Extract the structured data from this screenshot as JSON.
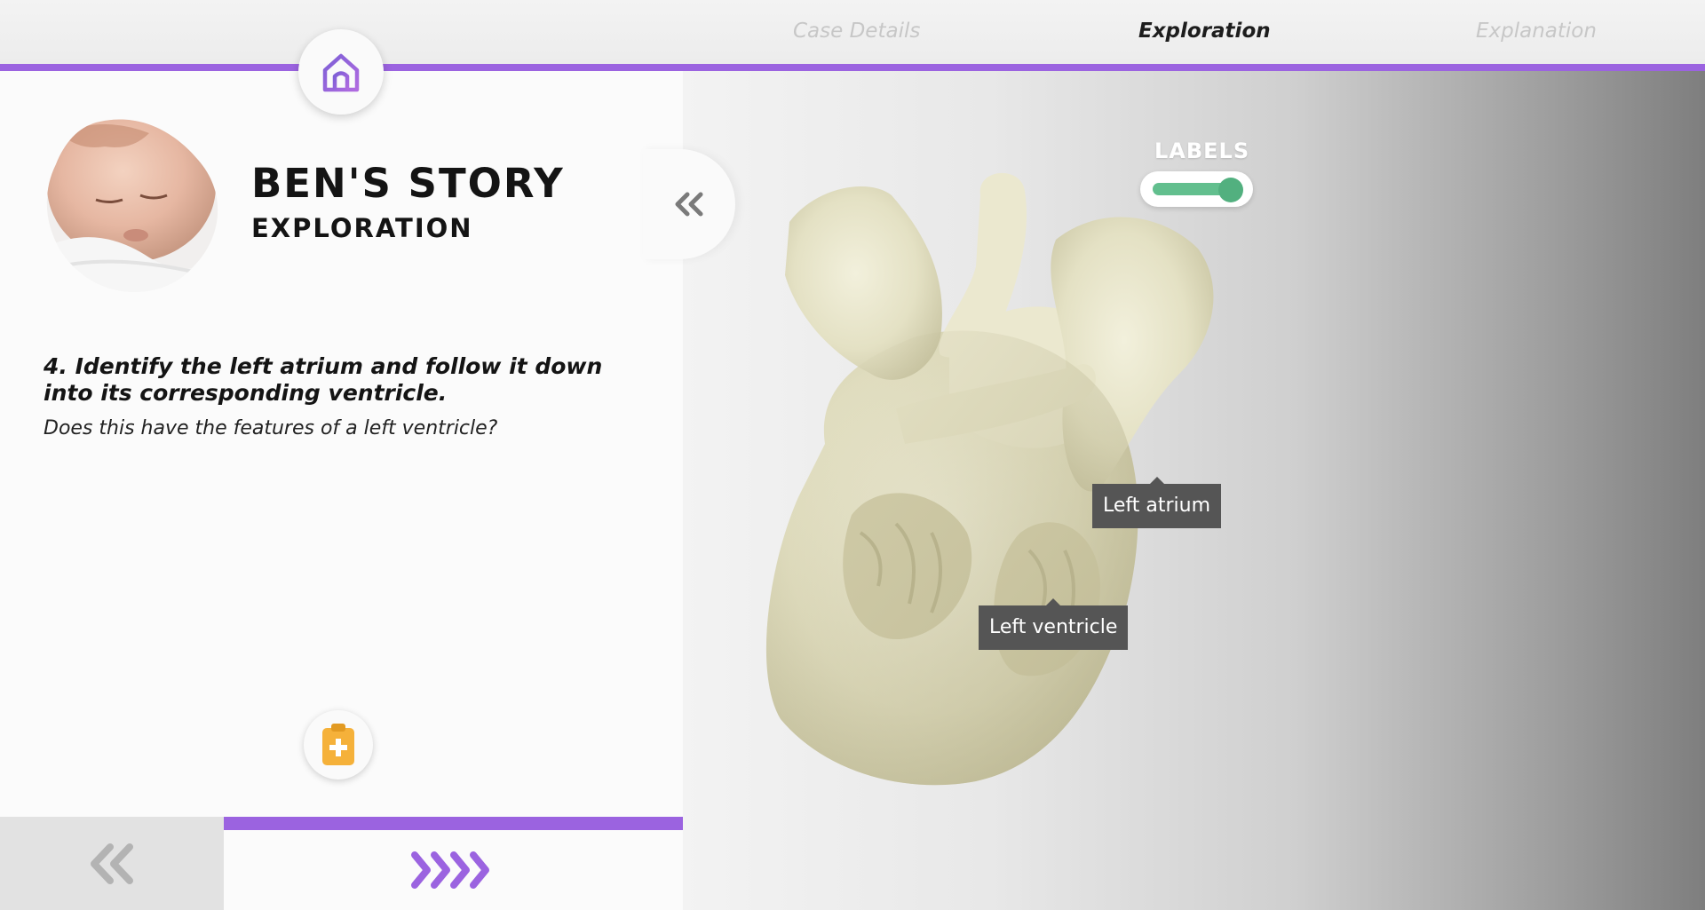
{
  "nav": {
    "tabs": [
      {
        "label": "Case Details",
        "state": "inactive"
      },
      {
        "label": "Exploration",
        "state": "active"
      },
      {
        "label": "Explanation",
        "state": "inactive"
      }
    ],
    "home_icon": "home-icon"
  },
  "story": {
    "title": "BEN'S STORY",
    "subtitle": "EXPLORATION",
    "question": "4. Identify the left atrium and follow it down into its corresponding ventricle.",
    "subquestion": "Does this have the features of a left ventricle?",
    "collapse_icon": "double-chevron-left-icon",
    "notes_icon": "clipboard-plus-icon"
  },
  "footer": {
    "prev_icon": "double-chevron-left-icon",
    "next_icon": "quadruple-chevron-right-icon"
  },
  "viewer": {
    "labels_title": "LABELS",
    "labels_enabled": true,
    "tags": [
      {
        "label": "Left atrium"
      },
      {
        "label": "Left ventricle"
      }
    ]
  },
  "colors": {
    "accent": "#9b63e0",
    "toggle_on": "#62bf8e",
    "notes_icon": "#f5b13a",
    "tag_bg": "#555555"
  }
}
